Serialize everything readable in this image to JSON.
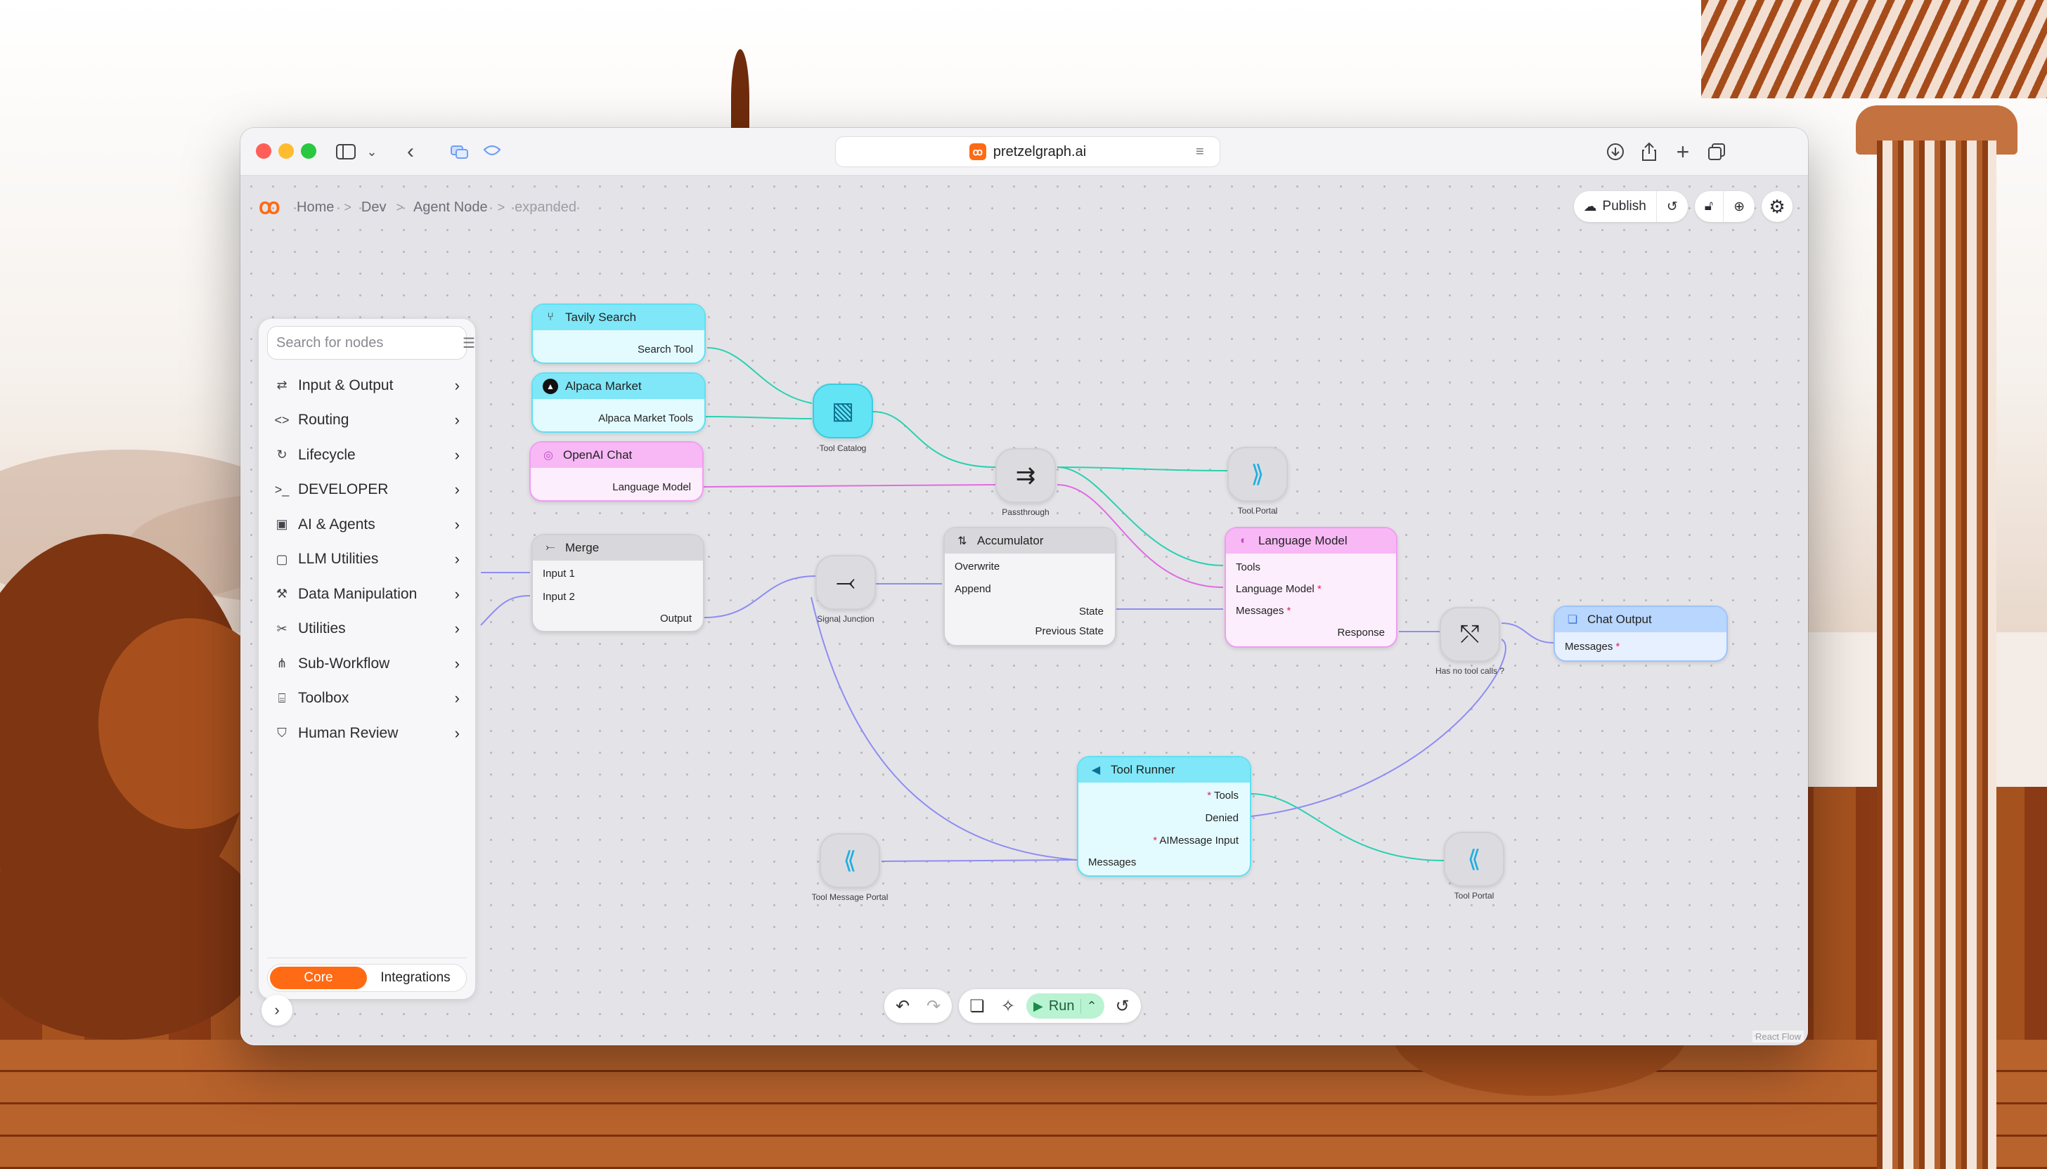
{
  "browser": {
    "url": "pretzelgraph.ai",
    "favicon_icon": "pretzel-logo-icon"
  },
  "breadcrumb": {
    "items": [
      "Home",
      "Dev",
      "Agent Node",
      "expanded"
    ],
    "separator": ">"
  },
  "toolbar": {
    "publish_label": "Publish"
  },
  "sidebar": {
    "search_placeholder": "Search for nodes",
    "categories": [
      {
        "label": "Input & Output",
        "icon": "io-icon"
      },
      {
        "label": "Routing",
        "icon": "code-brackets-icon"
      },
      {
        "label": "Lifecycle",
        "icon": "lifecycle-icon"
      },
      {
        "label": "DEVELOPER",
        "icon": "terminal-icon"
      },
      {
        "label": "AI & Agents",
        "icon": "robot-icon"
      },
      {
        "label": "LLM Utilities",
        "icon": "chat-bot-icon"
      },
      {
        "label": "Data Manipulation",
        "icon": "wand-icon"
      },
      {
        "label": "Utilities",
        "icon": "tools-icon"
      },
      {
        "label": "Sub-Workflow",
        "icon": "workflow-icon"
      },
      {
        "label": "Toolbox",
        "icon": "toolbox-icon"
      },
      {
        "label": "Human Review",
        "icon": "shield-person-icon"
      }
    ],
    "tabs": {
      "core": "Core",
      "integrations": "Integrations",
      "active": "Core"
    }
  },
  "nodes": {
    "tavily": {
      "title": "Tavily Search",
      "output": "Search Tool"
    },
    "alpaca": {
      "title": "Alpaca Market",
      "output": "Alpaca Market Tools"
    },
    "openai": {
      "title": "OpenAI Chat",
      "output": "Language Model"
    },
    "merge": {
      "title": "Merge",
      "input1": "Input 1",
      "input2": "Input 2",
      "output": "Output"
    },
    "accumulator": {
      "title": "Accumulator",
      "overwrite": "Overwrite",
      "append": "Append",
      "state": "State",
      "previous_state": "Previous State"
    },
    "language_model": {
      "title": "Language Model",
      "tools": "Tools",
      "language_model": "Language Model",
      "messages": "Messages",
      "response": "Response"
    },
    "chat_output": {
      "title": "Chat Output",
      "messages": "Messages"
    },
    "tool_runner": {
      "title": "Tool Runner",
      "tools": "Tools",
      "denied": "Denied",
      "ai_message_input": "AIMessage Input",
      "messages": "Messages"
    }
  },
  "round_nodes": {
    "tool_catalog": "Tool Catalog",
    "passthrough": "Passthrough",
    "tool_portal_top": "Tool Portal",
    "signal_junction": "Signal Junction",
    "has_no_tool_calls": "Has no tool calls ?",
    "tool_message_portal": "Tool Message Portal",
    "tool_portal_bottom": "Tool Portal"
  },
  "required_mark": "*",
  "bottom_bar": {
    "run_label": "Run"
  },
  "attribution": "React Flow",
  "colors": {
    "brand": "#ff6a14",
    "tool_edge": "#2bd0b0",
    "model_edge": "#e26be0",
    "flow_edge": "#8e8cf2"
  }
}
